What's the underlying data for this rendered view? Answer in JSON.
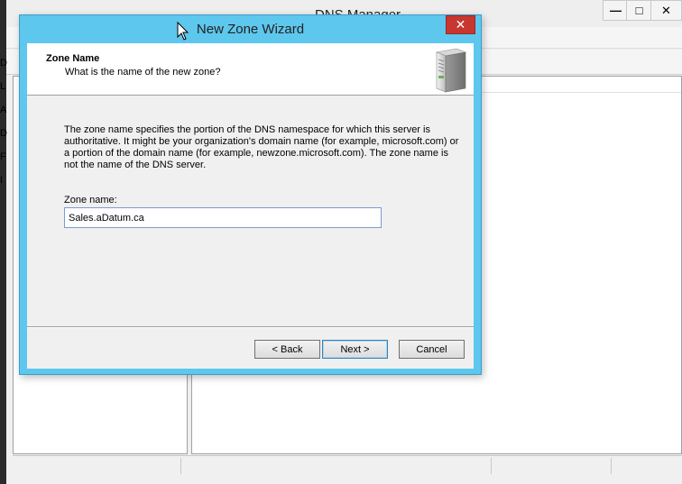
{
  "background_window": {
    "title": "DNS Manager",
    "caption_buttons": {
      "minimize": "—",
      "maximize": "□",
      "close": "✕"
    },
    "left_pane_letters": [
      "D",
      "L",
      "A",
      "D",
      "F",
      "I"
    ]
  },
  "wizard": {
    "title": "New Zone Wizard",
    "close_glyph": "✕",
    "heading": "Zone Name",
    "subheading": "What is the name of the new zone?",
    "description": "The zone name specifies the portion of the DNS namespace for which this server is authoritative. It might be your organization's domain name (for example,  microsoft.com) or a portion of the domain name (for example, newzone.microsoft.com). The zone name is not the name of the DNS server.",
    "zone_name_label": "Zone name:",
    "zone_name_value": "Sales.aDatum.ca",
    "buttons": {
      "back": "< Back",
      "next": "Next >",
      "cancel": "Cancel"
    },
    "icon": "server-icon"
  },
  "colors": {
    "wizard_frame": "#5dc7ed",
    "close_button": "#c7372f"
  }
}
